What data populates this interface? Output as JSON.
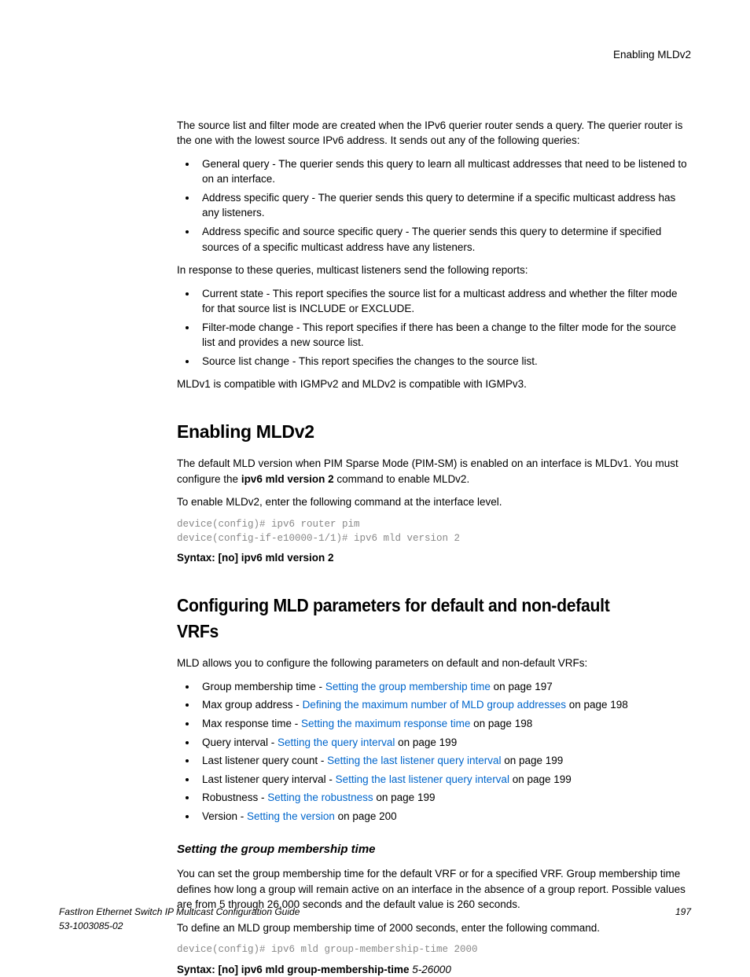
{
  "header": {
    "right": "Enabling MLDv2"
  },
  "intro": "The source list and filter mode are created when the IPv6 querier router sends a query. The querier router is the one with the lowest source IPv6 address. It sends out any of the following queries:",
  "queries": [
    "General query - The querier sends this query to learn all multicast addresses that need to be listened to on an interface.",
    "Address specific query - The querier sends this query to determine if a specific multicast address has any listeners.",
    "Address specific and source specific query - The querier sends this query to determine if specified sources of a specific multicast address have any listeners."
  ],
  "reports_intro": "In response to these queries, multicast listeners send the following reports:",
  "reports": [
    "Current state - This report specifies the source list for a multicast address and whether the filter mode for that source list is INCLUDE or EXCLUDE.",
    "Filter-mode change - This report specifies if there has been a change to the filter mode for the source list and provides a new source list.",
    "Source list change - This report specifies the changes to the source list."
  ],
  "compat": "MLDv1 is compatible with IGMPv2 and MLDv2 is compatible with IGMPv3.",
  "sec1": {
    "title": "Enabling MLDv2",
    "p1a": "The default MLD version when PIM Sparse Mode (PIM-SM) is enabled on an interface is MLDv1. You must configure the ",
    "p1b": "ipv6 mld version 2",
    "p1c": " command to enable MLDv2.",
    "p2": "To enable MLDv2, enter the following command at the interface level.",
    "code": "device(config)# ipv6 router pim\ndevice(config-if-e10000-1/1)# ipv6 mld version 2",
    "syntax": "Syntax: [no] ipv6 mld version 2"
  },
  "sec2": {
    "title": "Configuring MLD parameters for default and non-default VRFs",
    "p1": "MLD allows you to configure the following parameters on default and non-default VRFs:",
    "items": [
      {
        "pre": "Group membership time - ",
        "link": "Setting the group membership time",
        "post": " on page 197"
      },
      {
        "pre": "Max group address - ",
        "link": "Defining the maximum number of MLD group addresses",
        "post": " on page 198"
      },
      {
        "pre": "Max response time - ",
        "link": "Setting the maximum response time",
        "post": " on page 198"
      },
      {
        "pre": "Query interval - ",
        "link": "Setting the query interval",
        "post": " on page 199"
      },
      {
        "pre": "Last listener query count - ",
        "link": "Setting the last listener query interval",
        "post": " on page 199"
      },
      {
        "pre": "Last listener query interval - ",
        "link": "Setting the last listener query interval",
        "post": " on page 199"
      },
      {
        "pre": "Robustness - ",
        "link": "Setting the robustness",
        "post": " on page 199"
      },
      {
        "pre": "Version - ",
        "link": "Setting the version",
        "post": " on page 200"
      }
    ],
    "sub": {
      "title": "Setting the group membership time",
      "p1": "You can set the group membership time for the default VRF or for a specified VRF. Group membership time defines how long a group will remain active on an interface in the absence of a group report. Possible values are from 5 through 26,000 seconds and the default value is 260 seconds.",
      "p2": "To define an MLD group membership time of 2000 seconds, enter the following command.",
      "code": "device(config)# ipv6 mld group-membership-time 2000",
      "syntax_pre": "Syntax: [no] ipv6 mld group-membership-time ",
      "syntax_arg": "5-26000"
    }
  },
  "footer": {
    "title": "FastIron Ethernet Switch IP Multicast Configuration Guide",
    "docnum": "53-1003085-02",
    "page": "197"
  }
}
